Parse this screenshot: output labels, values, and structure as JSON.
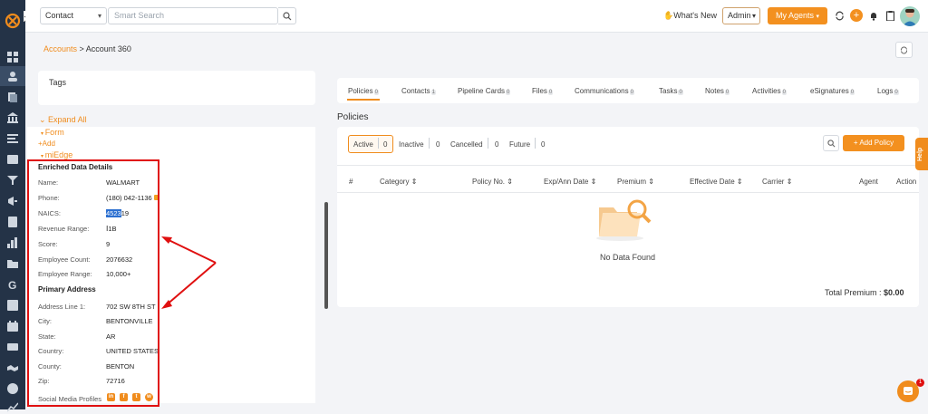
{
  "topbar": {
    "context_select": "Contact",
    "search_placeholder": "Smart Search",
    "whats_new": "What's New",
    "role_select": "Admin",
    "agents_button": "My Agents",
    "plus_glyph": "+"
  },
  "breadcrumb": {
    "root": "Accounts",
    "separator": " > ",
    "current": "Account 360"
  },
  "left": {
    "tags_title": "Tags",
    "expand_all": "Expand All",
    "form": "Form",
    "add": "+Add",
    "miedge": "miEdge",
    "enriched_title": "Enriched Data Details",
    "details": [
      {
        "label": "Name:",
        "value": "WALMART"
      },
      {
        "label": "Phone:",
        "value": "(180) 042-1136"
      },
      {
        "label": "NAICS:",
        "value": "452319"
      },
      {
        "label": "Revenue Range:",
        "value": "1B"
      },
      {
        "label": "Score:",
        "value": "9"
      },
      {
        "label": "Employee Count:",
        "value": "2076632"
      },
      {
        "label": "Employee Range:",
        "value": "10,000+"
      }
    ],
    "naics_selected": "4523",
    "naics_rest": "19",
    "address_title": "Primary Address",
    "address": [
      {
        "label": "Address Line 1:",
        "value": "702 SW 8TH ST"
      },
      {
        "label": "City:",
        "value": "BENTONVILLE"
      },
      {
        "label": "State:",
        "value": "AR"
      },
      {
        "label": "Country:",
        "value": "UNITED STATES"
      },
      {
        "label": "County:",
        "value": "BENTON"
      },
      {
        "label": "Zip:",
        "value": "72716"
      }
    ],
    "social_label": "Social Media Profiles",
    "social_icons": [
      "in",
      "f",
      "t",
      "w"
    ]
  },
  "tabs": [
    {
      "label": "Policies",
      "count": "0"
    },
    {
      "label": "Contacts",
      "count": "1"
    },
    {
      "label": "Pipeline Cards",
      "count": "0"
    },
    {
      "label": "Files",
      "count": "0"
    },
    {
      "label": "Communications",
      "count": "0"
    },
    {
      "label": "Tasks",
      "count": "0"
    },
    {
      "label": "Notes",
      "count": "0"
    },
    {
      "label": "Activities",
      "count": "0"
    },
    {
      "label": "eSignatures",
      "count": "0"
    },
    {
      "label": "Logs",
      "count": "0"
    }
  ],
  "policies": {
    "title": "Policies",
    "filters": [
      {
        "label": "Active",
        "count": "0"
      },
      {
        "label": "Inactive",
        "count": "0"
      },
      {
        "label": "Cancelled",
        "count": "0"
      },
      {
        "label": "Future",
        "count": "0"
      }
    ],
    "add_button": "+ Add Policy",
    "columns": [
      "#",
      "Category",
      "Policy No.",
      "Exp/Ann Date",
      "Premium",
      "Effective Date",
      "Carrier",
      "Agent",
      "Action"
    ],
    "sort_glyph": "⇕",
    "empty_text": "No Data Found",
    "total_label": "Total Premium : ",
    "total_value": "$0.00"
  },
  "help": "Help",
  "chat_badge": "1",
  "colors": {
    "accent": "#f3901f",
    "sidebar": "#243347",
    "annotation": "#e01010"
  }
}
